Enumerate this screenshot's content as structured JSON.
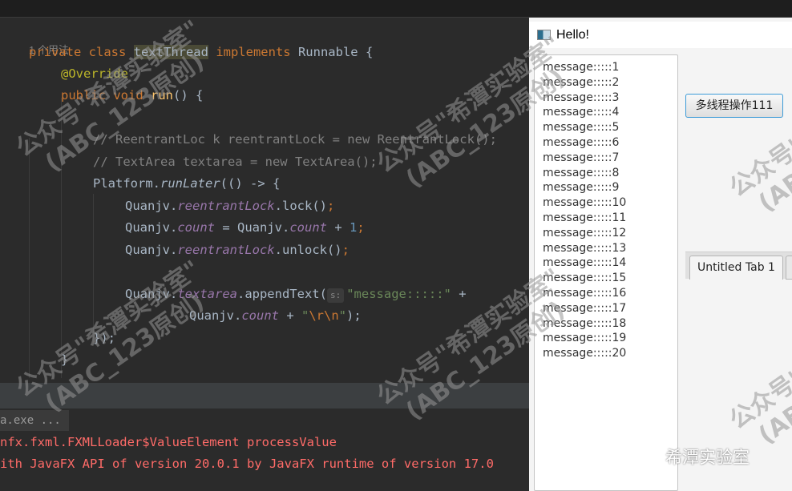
{
  "editor": {
    "usage_hint": "1 个用法",
    "lines": {
      "l1": {
        "kw": "private class ",
        "cls": "textThread",
        "kw2": " implements ",
        "rest": "Runnable {"
      },
      "l2": {
        "ann": "@Override"
      },
      "l3": {
        "kw": "public void ",
        "fn": "run",
        "rest": "() {"
      },
      "l4": {
        "cm": "// ReentrantLoc k reentrantLock = new ReentrantLock();"
      },
      "l5": {
        "cm": "// TextArea textarea = new TextArea();"
      },
      "l6": {
        "a": "Platform.",
        "it": "runLater",
        "b": "(() -> {"
      },
      "l7": {
        "a": "Quanjv.",
        "fld": "reentrantLock",
        "b": ".lock()",
        "semi": ";"
      },
      "l8": {
        "a": "Quanjv.",
        "fld": "count",
        "b": " = Quanjv.",
        "fld2": "count",
        "c": " + ",
        "num": "1",
        "semi": ";"
      },
      "l9": {
        "a": "Quanjv.",
        "fld": "reentrantLock",
        "b": ".unlock()",
        "semi": ";"
      },
      "l10": {
        "a": "Quanjv.",
        "fld": "textarea",
        "b": ".appendText(",
        "inlay": "s:",
        "str": "\"message:::::\"",
        "c": " +"
      },
      "l11": {
        "a": "Quanjv.",
        "fld": "count",
        "b": " + ",
        "q1": "\"",
        "esc": "\\r\\n",
        "q2": "\"",
        "c": ");"
      },
      "l12": {
        "a": "});"
      },
      "l13": {
        "a": "}"
      }
    }
  },
  "console": {
    "run_tab": "a.exe ...",
    "errors": [
      "nfx.fxml.FXMLLoader$ValueElement processValue",
      "ith JavaFX API of version 20.0.1 by JavaFX runtime of version 17.0"
    ]
  },
  "fx_window": {
    "title": "Hello!",
    "textarea_lines": [
      "message:::::1",
      "message:::::2",
      "message:::::3",
      "message:::::4",
      "message:::::5",
      "message:::::6",
      "message:::::7",
      "message:::::8",
      "message:::::9",
      "message:::::10",
      "message:::::11",
      "message:::::12",
      "message:::::13",
      "message:::::14",
      "message:::::15",
      "message:::::16",
      "message:::::17",
      "message:::::18",
      "message:::::19",
      "message:::::20"
    ],
    "button_label": "多线程操作111",
    "tab_label": "Untitled Tab 1"
  },
  "watermark": {
    "line1": "公众号\"希潭实验室\"",
    "line2": "(ABC_123原创)"
  },
  "wechat_badge": {
    "label": "希潭实验室"
  }
}
